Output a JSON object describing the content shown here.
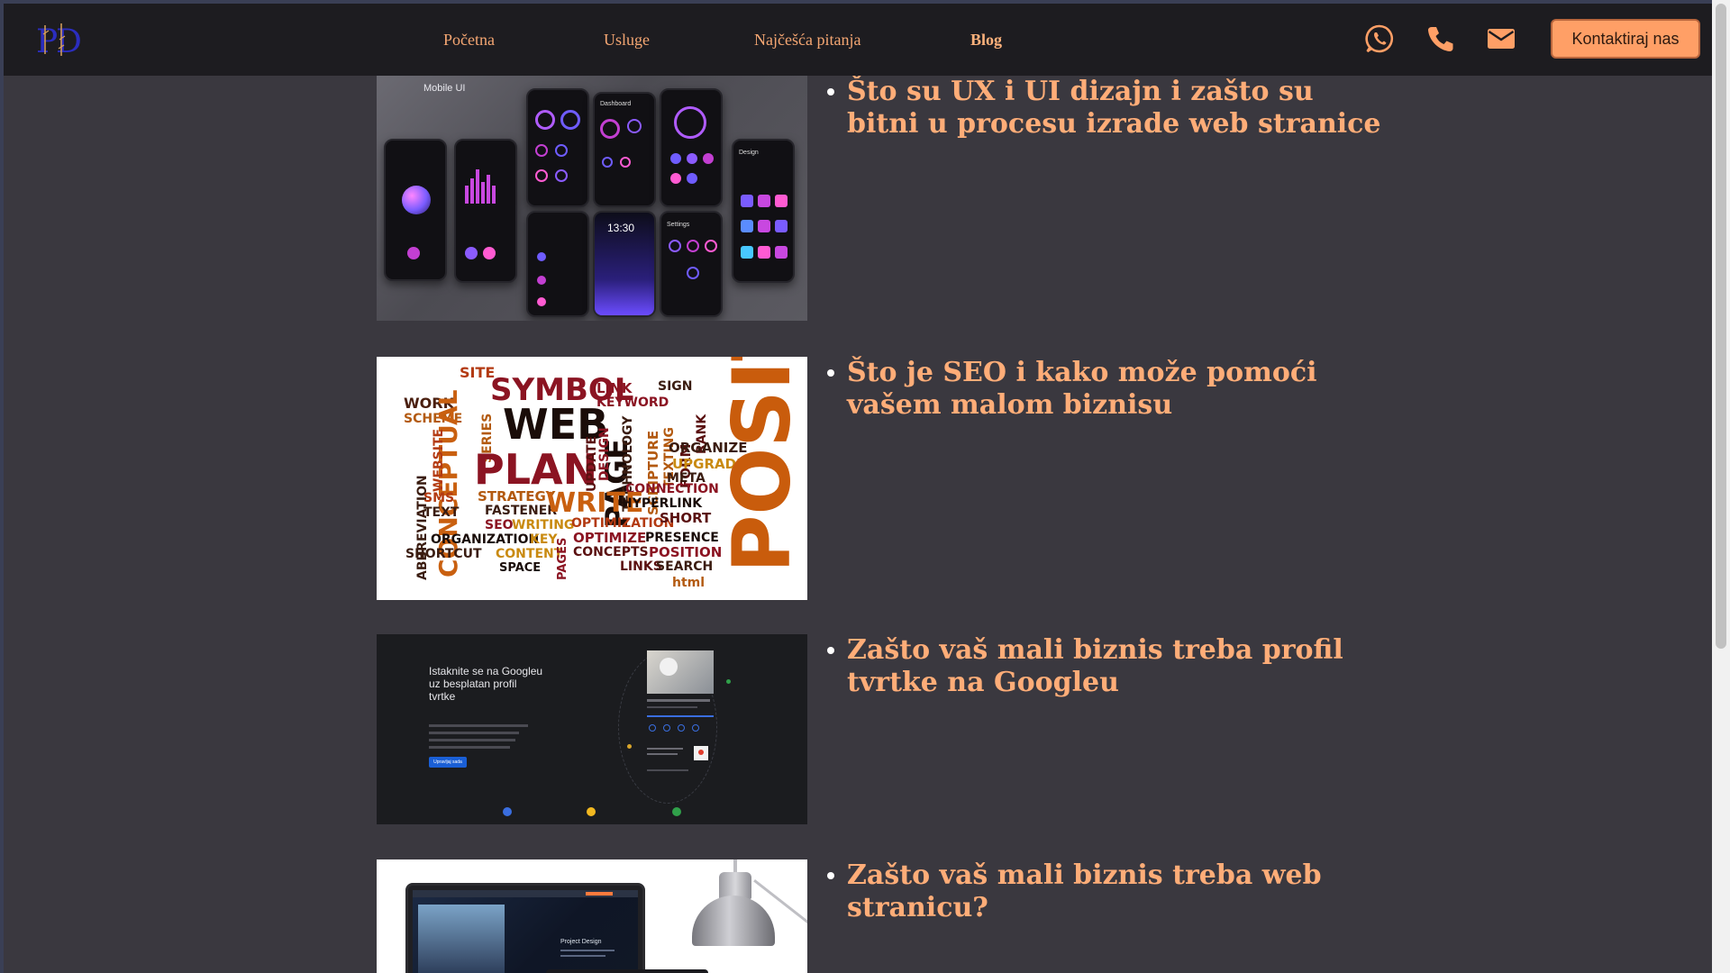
{
  "brand": {
    "logo_text": "PD"
  },
  "nav": {
    "links": [
      {
        "label": "Početna"
      },
      {
        "label": "Usluge"
      },
      {
        "label": "Najčešća pitanja"
      },
      {
        "label": "Blog",
        "active": true
      }
    ],
    "contact_icons": [
      "whatsapp-icon",
      "phone-icon",
      "mail-icon"
    ],
    "cta_label": "Kontaktiraj nas"
  },
  "colors": {
    "page_bg": "#3a383f",
    "header_bg": "#1d1c20",
    "accent": "#ff9f66",
    "title": "#ffad78"
  },
  "posts": [
    {
      "title": "Što su UX i UI dizajn i zašto su bitni u procesu izrade web stranice",
      "image": "mobile-ui-phones",
      "image_caption": "Mobile UI",
      "phone_clock": "13:30",
      "phone_labels": [
        "Dashboard",
        "Settings",
        "Design"
      ]
    },
    {
      "title": "Što je SEO i kako može pomoći vašem malom biznisu",
      "image": "seo-word-cloud"
    },
    {
      "title": "Zašto vaš mali biznis treba profil tvrtke na Googleu",
      "image": "google-business-profile",
      "image_text": {
        "heading": "Istaknite se na Googleu uz besplatan profil tvrtke",
        "button": "Upravljaj sada"
      }
    },
    {
      "title": "Zašto vaš mali biznis treba web stranicu?",
      "image": "laptop-lamp",
      "image_text": {
        "heading": "Project Design"
      }
    }
  ],
  "seo_words": [
    "SITE",
    "SYMBOL",
    "LINK",
    "SIGN",
    "WORK",
    "KEYWORD",
    "SCHEME",
    "WEB",
    "CONCEPTUAL",
    "SERIES",
    "PAGE",
    "FORM",
    "TEXTING",
    "RANK",
    "WEBSITE",
    "PLAN",
    "DESIGN",
    "TECHNOLOGY",
    "SCRIPTURE",
    "ORGANIZE",
    "UPGRADE",
    "UPDATE",
    "META",
    "ABBREVIATION",
    "SMS",
    "STRATEGY",
    "CONNECTION",
    "TEXT",
    "FASTENER",
    "WRITE",
    "HYPERLINK",
    "SEO",
    "WRITING",
    "OPTIMIZATION",
    "SHORT",
    "ORGANIZATION",
    "KEY",
    "OPTIMIZE",
    "PRESENCE",
    "SHORTCUT",
    "CONTENT",
    "CONCEPTS",
    "POSITION",
    "SPACE",
    "PAGES",
    "LINKS",
    "SEARCH",
    "html"
  ]
}
